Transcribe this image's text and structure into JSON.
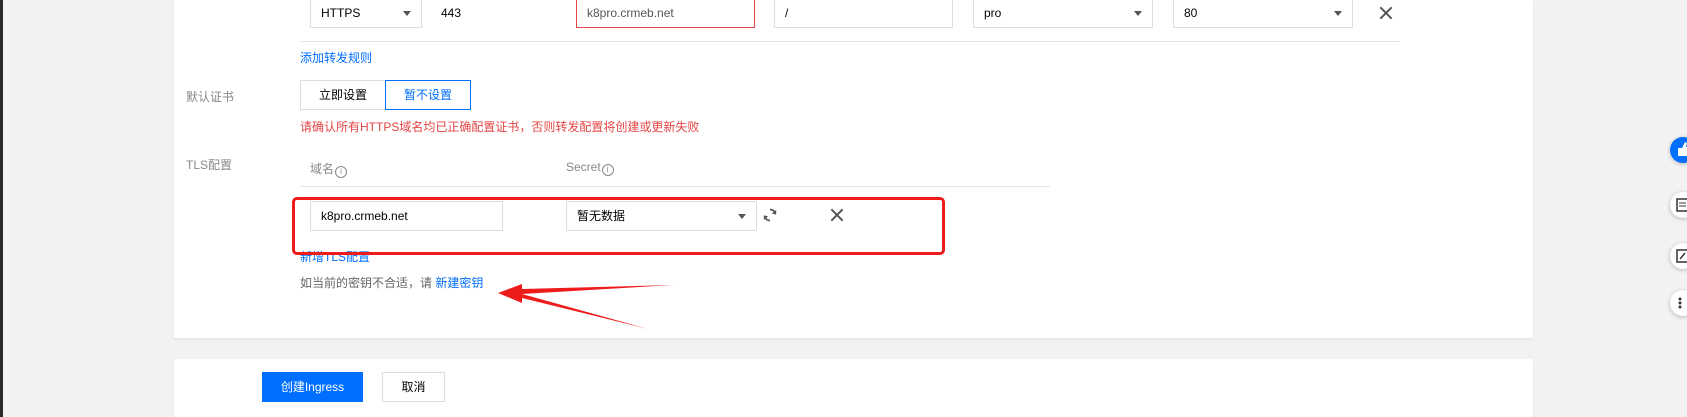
{
  "rule_row": {
    "protocol": "HTTPS",
    "port": "443",
    "host": "k8pro.crmeb.net",
    "path": "/",
    "service": "pro",
    "service_port": "80"
  },
  "add_rule_link": "添加转发规则",
  "default_cert": {
    "label": "默认证书",
    "option_set_now": "立即设置",
    "option_skip": "暂不设置",
    "warning": "请确认所有HTTPS域名均已正确配置证书，否则转发配置将创建或更新失败"
  },
  "tls": {
    "label": "TLS配置",
    "col_domain": "域名",
    "col_secret": "Secret",
    "info_glyph": "i",
    "row": {
      "domain": "k8pro.crmeb.net",
      "secret": "暂无数据"
    },
    "add_link": "新增TLS配置",
    "hint_prefix": "如当前的密钥不合适，请",
    "new_secret_link": "新建密钥"
  },
  "footer": {
    "create_button": "创建Ingress",
    "cancel_button": "取消"
  },
  "colors": {
    "accent": "#006eff",
    "error": "#e54545",
    "annotation": "#ee1b1b"
  },
  "icons": {
    "refresh": "refresh-icon",
    "close": "close-icon",
    "info": "info-icon",
    "caret": "chevron-down-icon"
  }
}
